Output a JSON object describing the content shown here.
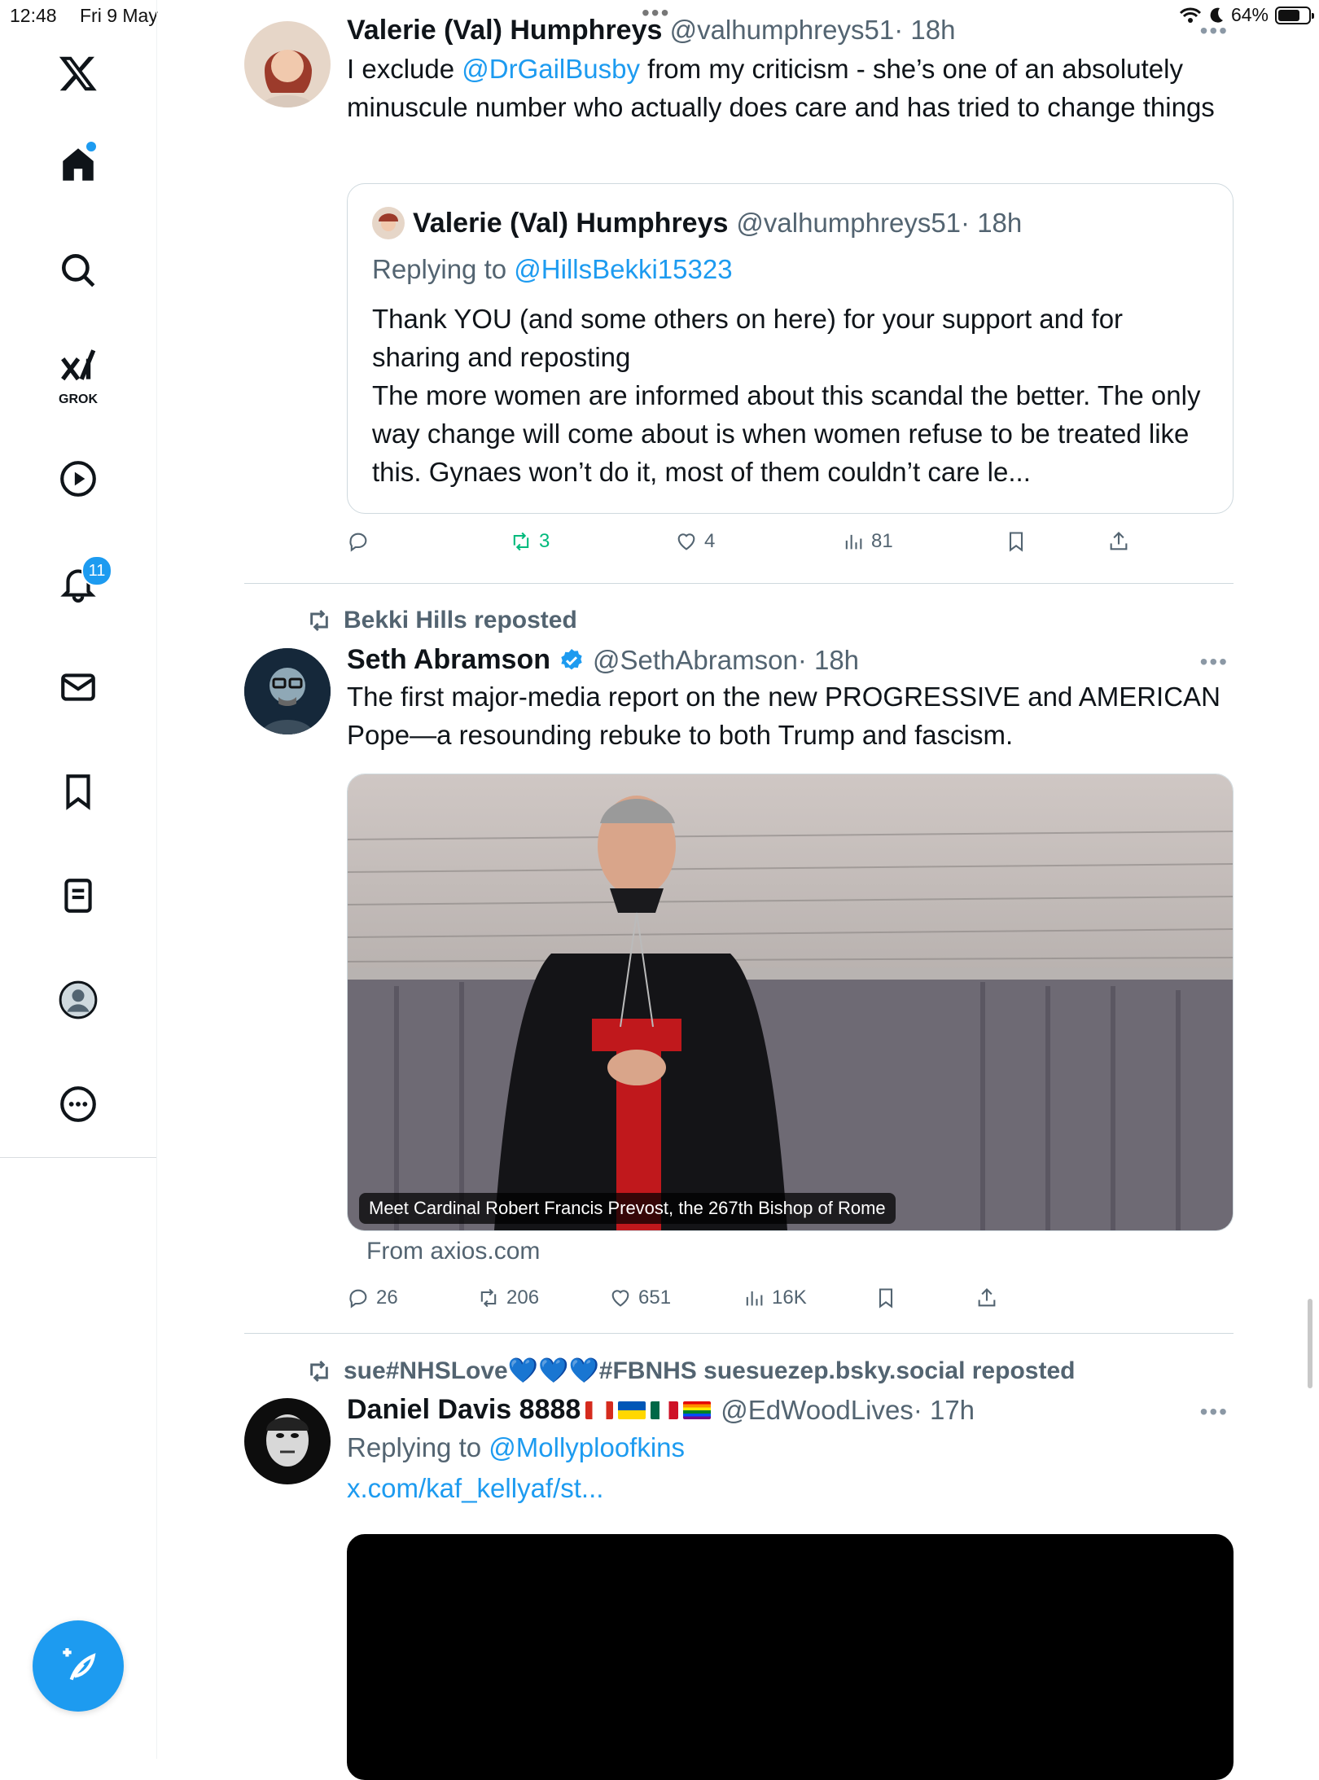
{
  "status_bar": {
    "time": "12:48",
    "date": "Fri 9 May",
    "battery": "64%"
  },
  "sidebar": {
    "items": [
      {
        "name": "home",
        "label": "Home"
      },
      {
        "name": "explore",
        "label": "Explore"
      },
      {
        "name": "grok",
        "label": "GROK"
      },
      {
        "name": "video",
        "label": "Video"
      },
      {
        "name": "notifications",
        "label": "Notifications",
        "badge": "11"
      },
      {
        "name": "messages",
        "label": "Messages"
      },
      {
        "name": "bookmarks",
        "label": "Bookmarks"
      },
      {
        "name": "lists",
        "label": "Lists"
      },
      {
        "name": "profile",
        "label": "Profile"
      },
      {
        "name": "more",
        "label": "More"
      }
    ]
  },
  "tweets": [
    {
      "name": "Valerie (Val) Humphreys",
      "handle": "@valhumphreys51",
      "time": "· 18h",
      "text_pre": "I exclude ",
      "mention": "@DrGailBusby",
      "text_post": " from my criticism - she’s one of an absolutely minuscule number who actually does care and has tried to change things",
      "quote": {
        "name": "Valerie (Val) Humphreys",
        "handle": "@valhumphreys51",
        "time": "· 18h",
        "replying_label": "Replying to",
        "replying_to": "@HillsBekki15323",
        "text_line1": "Thank YOU (and some others on here) for your support and for sharing and reposting",
        "text_line2": "The more women are informed about this scandal the better. The only way change will come about is when women refuse to be treated like this. Gynaes won’t do it, most of them couldn’t care le..."
      },
      "stats": {
        "replies": "",
        "reposts": "3",
        "likes": "4",
        "views": "81"
      }
    },
    {
      "reposted_by": "Bekki Hills reposted",
      "name": "Seth Abramson",
      "handle": "@SethAbramson",
      "time": "· 18h",
      "text": "The first major-media report on the new PROGRESSIVE and AMERICAN Pope—a resounding rebuke to both Trump and fascism.",
      "media_caption": "Meet Cardinal Robert Francis Prevost, the 267th Bishop of Rome",
      "link_source": "From axios.com",
      "stats": {
        "replies": "26",
        "reposts": "206",
        "likes": "651",
        "views": "16K"
      }
    },
    {
      "reposted_by": "sue#NHSLove💙💙💙#FBNHS suesuezep.bsky.social reposted",
      "name": "Daniel Davis 8888",
      "handle": "@EdWoodLives",
      "time": "· 17h",
      "replying_label": "Replying to",
      "replying_to": "@Mollyploofkins",
      "link": "x.com/kaf_kellyaf/st..."
    }
  ],
  "colors": {
    "accent": "#1d9bf0",
    "repost_green": "#00ba7c",
    "secondary_text": "#536471"
  }
}
